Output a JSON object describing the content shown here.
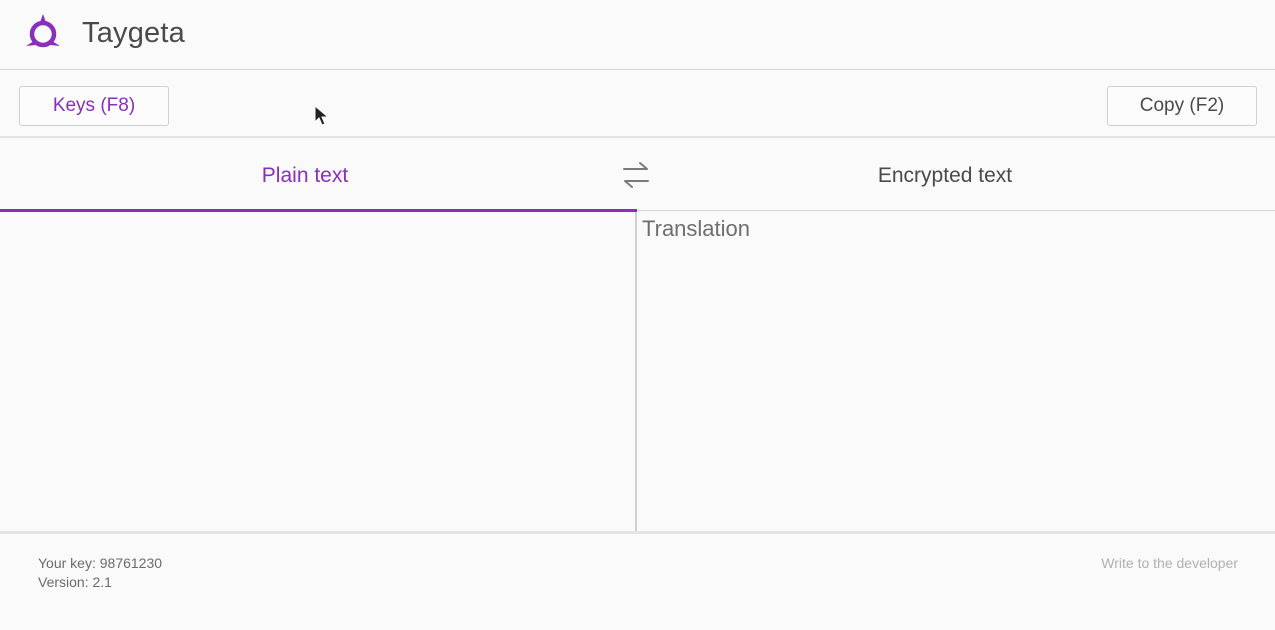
{
  "app": {
    "title": "Taygeta",
    "accent_color": "#8a2fbd"
  },
  "toolbar": {
    "keys_label": "Keys (F8)",
    "copy_label": "Copy (F2)"
  },
  "tabs": {
    "plain_label": "Plain text",
    "encrypted_label": "Encrypted text",
    "active": "plain",
    "swap_icon": "swap-arrows-icon"
  },
  "editor": {
    "input_value": "",
    "output_placeholder": "Translation"
  },
  "footer": {
    "key_text": "Your key: 98761230",
    "version_text": "Version: 2.1",
    "contact_label": "Write to the developer"
  }
}
